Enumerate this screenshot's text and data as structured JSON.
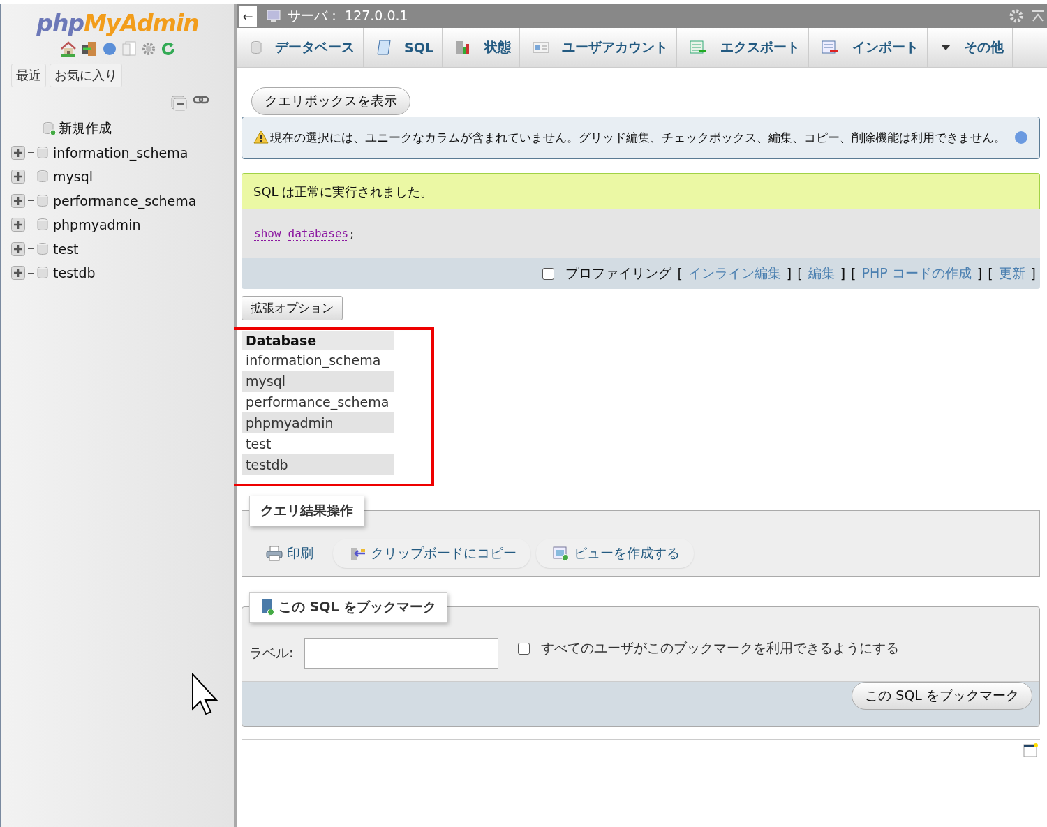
{
  "sidebar": {
    "logo": {
      "first": "php",
      "second": "MyAdmin"
    },
    "tabs": [
      "最近",
      "お気に入り"
    ],
    "tree": {
      "new_item": "新規作成",
      "databases": [
        {
          "name": "information_schema",
          "expanded": false
        },
        {
          "name": "mysql",
          "expanded": false
        },
        {
          "name": "performance_schema",
          "expanded": false
        },
        {
          "name": "phpmyadmin",
          "expanded": false
        },
        {
          "name": "test",
          "expanded": false
        },
        {
          "name": "testdb",
          "expanded": false
        }
      ]
    }
  },
  "header": {
    "back": "←",
    "server": "サーバ： 127.0.0.1"
  },
  "nav_tabs": [
    {
      "label": "データベース",
      "kind": "db"
    },
    {
      "label": "SQL",
      "kind": "sql"
    },
    {
      "label": "状態",
      "kind": "status"
    },
    {
      "label": "ユーザアカウント",
      "kind": "users"
    },
    {
      "label": "エクスポート",
      "kind": "export"
    },
    {
      "label": "インポート",
      "kind": "import"
    },
    {
      "label": "その他",
      "kind": "more"
    }
  ],
  "query_box_button": "クエリボックスを表示",
  "notice": "現在の選択には、ユニークなカラムが含まれていません。グリッド編集、チェックボックス、編集、コピー、削除機能は利用できません。",
  "success": "SQL は正常に実行されました。",
  "sql": [
    {
      "text": "show",
      "kind": "keyword"
    },
    {
      "text": "databases",
      "kind": "keyword"
    },
    {
      "text": ";",
      "kind": "punct"
    }
  ],
  "profiling": {
    "checked": false,
    "label": "プロファイリング",
    "links": [
      {
        "open": "[",
        "label": "インライン編集",
        "close": "]"
      },
      {
        "open": "[",
        "label": "編集",
        "close": "]"
      },
      {
        "open": "[",
        "label": "PHP コードの作成",
        "close": "]"
      },
      {
        "open": "[",
        "label": "更新",
        "close": "]"
      }
    ]
  },
  "options_button": "拡張オプション",
  "results": {
    "column": "Database",
    "rows": [
      "information_schema",
      "mysql",
      "performance_schema",
      "phpmyadmin",
      "test",
      "testdb"
    ]
  },
  "result_ops": {
    "legend": "クエリ結果操作",
    "actions": [
      {
        "label": "印刷",
        "kind": "print"
      },
      {
        "label": "クリップボードにコピー",
        "kind": "copy"
      },
      {
        "label": "ビューを作成する",
        "kind": "view"
      }
    ]
  },
  "bookmark": {
    "legend": "この SQL をブックマーク",
    "label": "ラベル:",
    "share_checked": false,
    "share_label": "すべてのユーザがこのブックマークを利用できるようにする",
    "submit": "この SQL をブックマーク"
  }
}
